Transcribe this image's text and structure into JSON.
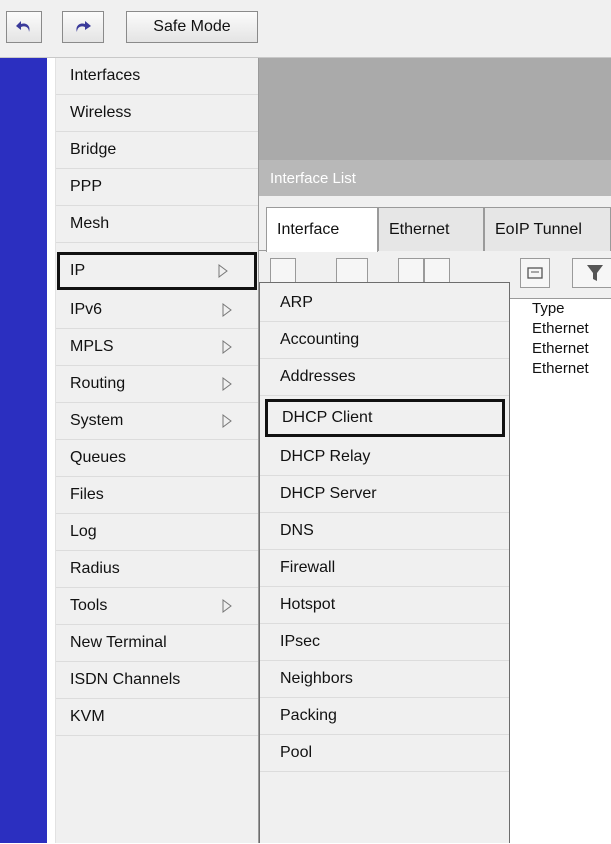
{
  "toolbar": {
    "undo_icon": "undo-icon",
    "redo_icon": "redo-icon",
    "safe_mode_label": "Safe Mode"
  },
  "menu": {
    "items": [
      {
        "label": "Interfaces",
        "submenu": false
      },
      {
        "label": "Wireless",
        "submenu": false
      },
      {
        "label": "Bridge",
        "submenu": false
      },
      {
        "label": "PPP",
        "submenu": false
      },
      {
        "label": "Mesh",
        "submenu": false
      },
      {
        "label": "IP",
        "submenu": true,
        "selected": true
      },
      {
        "label": "IPv6",
        "submenu": true
      },
      {
        "label": "MPLS",
        "submenu": true
      },
      {
        "label": "Routing",
        "submenu": true
      },
      {
        "label": "System",
        "submenu": true
      },
      {
        "label": "Queues",
        "submenu": false
      },
      {
        "label": "Files",
        "submenu": false
      },
      {
        "label": "Log",
        "submenu": false
      },
      {
        "label": "Radius",
        "submenu": false
      },
      {
        "label": "Tools",
        "submenu": true
      },
      {
        "label": "New Terminal",
        "submenu": false
      },
      {
        "label": "ISDN Channels",
        "submenu": false
      },
      {
        "label": "KVM",
        "submenu": false
      }
    ]
  },
  "window": {
    "title": "Interface List",
    "tabs": [
      "Interface",
      "Ethernet",
      "EoIP Tunnel"
    ],
    "column_header": "Type",
    "rows": [
      "Ethernet",
      "Ethernet",
      "Ethernet"
    ]
  },
  "submenu": {
    "items": [
      "ARP",
      "Accounting",
      "Addresses",
      "DHCP Client",
      "DHCP Relay",
      "DHCP Server",
      "DNS",
      "Firewall",
      "Hotspot",
      "IPsec",
      "Neighbors",
      "Packing",
      "Pool"
    ],
    "selected": "DHCP Client"
  },
  "colors": {
    "strip": "#2b2fc0",
    "menu_bg": "#f0f0f0",
    "selection_border": "#111111"
  }
}
